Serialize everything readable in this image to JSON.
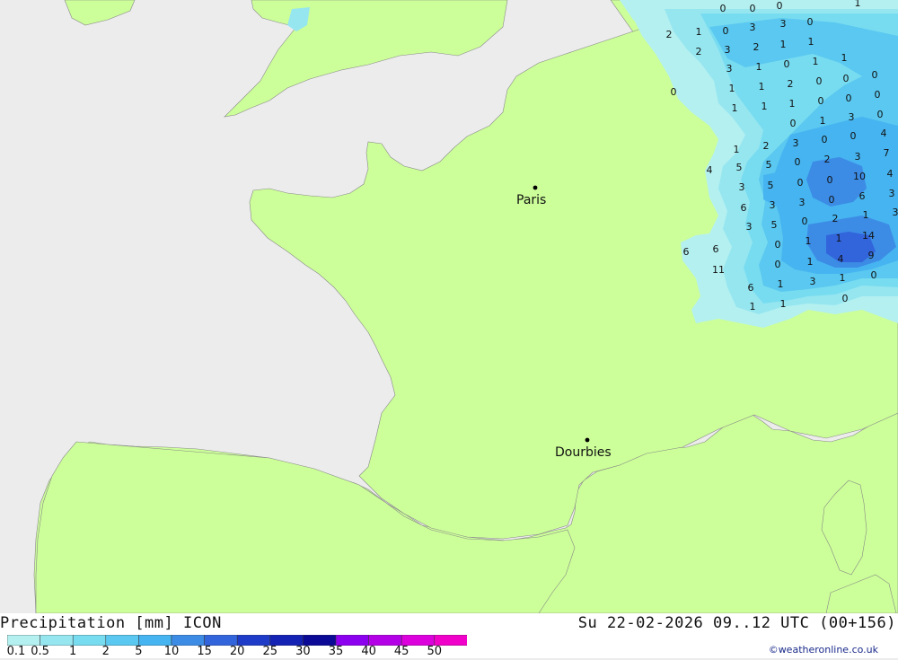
{
  "map": {
    "cities": [
      {
        "name": "Paris"
      },
      {
        "name": "Dourbies"
      }
    ],
    "land_color": "#ccff99",
    "sea_color": "#ececec",
    "precip_values": [
      "0",
      "0",
      "0",
      "1",
      "2",
      "1",
      "0",
      "3",
      "3",
      "0",
      "2",
      "3",
      "2",
      "1",
      "1",
      "3",
      "1",
      "0",
      "1",
      "1",
      "0",
      "1",
      "1",
      "2",
      "0",
      "0",
      "0",
      "1",
      "1",
      "1",
      "0",
      "0",
      "0",
      "0",
      "1",
      "3",
      "0",
      "1",
      "2",
      "3",
      "0",
      "0",
      "4",
      "4",
      "5",
      "5",
      "0",
      "2",
      "3",
      "7",
      "3",
      "5",
      "0",
      "0",
      "10",
      "4",
      "6",
      "3",
      "3",
      "0",
      "6",
      "3",
      "3",
      "5",
      "0",
      "2",
      "1",
      "3",
      "6",
      "6",
      "0",
      "1",
      "1",
      "14",
      "11",
      "0",
      "1",
      "4",
      "9",
      "6",
      "1",
      "3",
      "1",
      "0",
      "1",
      "1",
      "0",
      "1",
      "0"
    ]
  },
  "footer": {
    "title": "Precipitation [mm] ICON",
    "timestamp": "Su 22-02-2026 09..12 UTC (00+156)",
    "credit": "©weatheronline.co.uk"
  },
  "legend": {
    "labels": [
      "0.1",
      "0.5",
      "1",
      "2",
      "5",
      "10",
      "15",
      "20",
      "25",
      "30",
      "35",
      "40",
      "45",
      "50"
    ],
    "colors": [
      "#b4f0f0",
      "#96e6f0",
      "#78dcf0",
      "#5ac8f0",
      "#46b4f0",
      "#3c8ce6",
      "#3264dc",
      "#1e3cc8",
      "#1423b4",
      "#0a0a96",
      "#8c00f0",
      "#b400e6",
      "#dc00dc",
      "#f000c8",
      "#c800a0"
    ]
  }
}
